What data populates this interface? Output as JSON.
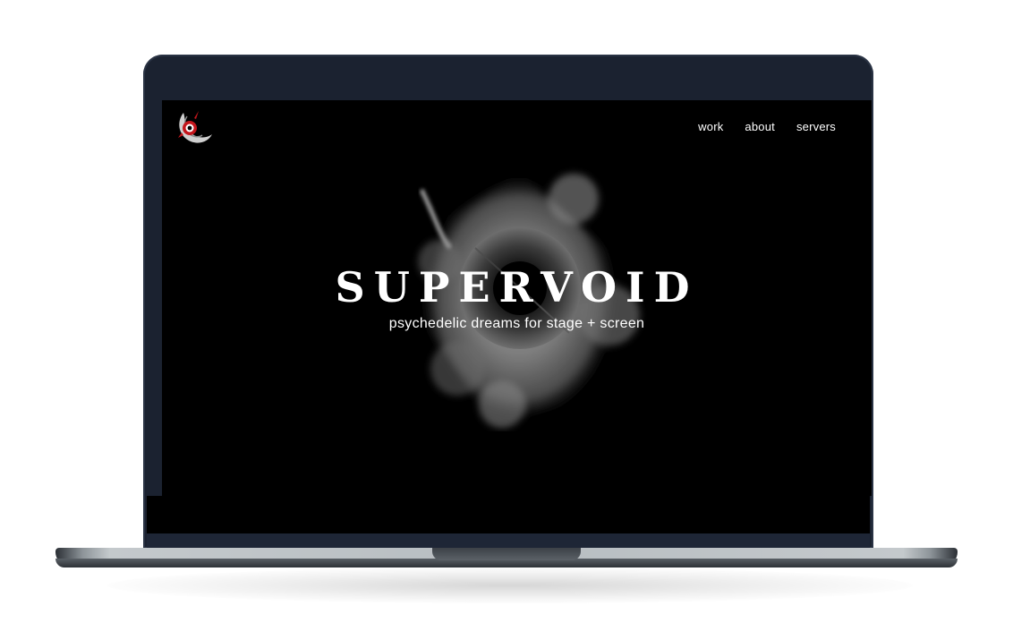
{
  "site": {
    "nav": {
      "work": "work",
      "about": "about",
      "servers": "servers"
    },
    "hero": {
      "title": "SUPERVOID",
      "subtitle": "psychedelic dreams for stage + screen"
    },
    "logo_icon": "red-crescent-eye-icon",
    "colors": {
      "background": "#000000",
      "text": "#ffffff",
      "logo_accent": "#c4161c",
      "device_frame": "#1b2230",
      "device_base": "#b7bdc1"
    }
  }
}
